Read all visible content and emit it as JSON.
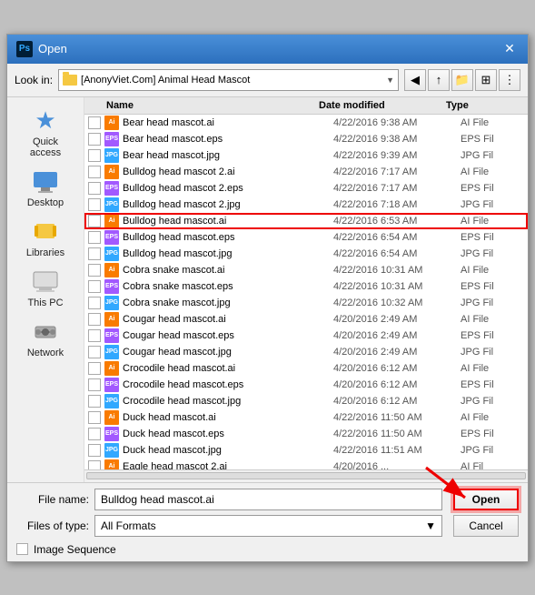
{
  "dialog": {
    "title": "Open",
    "ps_label": "Ps"
  },
  "toolbar": {
    "look_in_label": "Look in:",
    "look_in_value": "[AnonyViet.Com] Animal Head Mascot",
    "btn_back": "◀",
    "btn_up": "↑",
    "btn_folder": "📁",
    "btn_grid": "⊞",
    "btn_options": "⋮"
  },
  "sidebar": {
    "items": [
      {
        "id": "quick-access",
        "label": "Quick access",
        "icon": "star"
      },
      {
        "id": "desktop",
        "label": "Desktop",
        "icon": "desktop"
      },
      {
        "id": "libraries",
        "label": "Libraries",
        "icon": "libraries"
      },
      {
        "id": "this-pc",
        "label": "This PC",
        "icon": "pc"
      },
      {
        "id": "network",
        "label": "Network",
        "icon": "network"
      }
    ]
  },
  "file_list": {
    "columns": {
      "name": "Name",
      "date": "Date modified",
      "type": "Type"
    },
    "files": [
      {
        "name": "Bear head mascot.ai",
        "date": "4/22/2016 9:38 AM",
        "type": "AI File",
        "icon": "ai"
      },
      {
        "name": "Bear head mascot.eps",
        "date": "4/22/2016 9:38 AM",
        "type": "EPS Fil",
        "icon": "eps"
      },
      {
        "name": "Bear head mascot.jpg",
        "date": "4/22/2016 9:39 AM",
        "type": "JPG Fil",
        "icon": "jpg"
      },
      {
        "name": "Bulldog head mascot 2.ai",
        "date": "4/22/2016 7:17 AM",
        "type": "AI File",
        "icon": "ai"
      },
      {
        "name": "Bulldog head mascot 2.eps",
        "date": "4/22/2016 7:17 AM",
        "type": "EPS Fil",
        "icon": "eps"
      },
      {
        "name": "Bulldog head mascot 2.jpg",
        "date": "4/22/2016 7:18 AM",
        "type": "JPG Fil",
        "icon": "jpg"
      },
      {
        "name": "Bulldog head mascot.ai",
        "date": "4/22/2016 6:53 AM",
        "type": "AI File",
        "icon": "ai",
        "selected": true
      },
      {
        "name": "Bulldog head mascot.eps",
        "date": "4/22/2016 6:54 AM",
        "type": "EPS Fil",
        "icon": "eps"
      },
      {
        "name": "Bulldog head mascot.jpg",
        "date": "4/22/2016 6:54 AM",
        "type": "JPG Fil",
        "icon": "jpg"
      },
      {
        "name": "Cobra snake mascot.ai",
        "date": "4/22/2016 10:31 AM",
        "type": "AI File",
        "icon": "ai"
      },
      {
        "name": "Cobra snake mascot.eps",
        "date": "4/22/2016 10:31 AM",
        "type": "EPS Fil",
        "icon": "eps"
      },
      {
        "name": "Cobra snake mascot.jpg",
        "date": "4/22/2016 10:32 AM",
        "type": "JPG Fil",
        "icon": "jpg"
      },
      {
        "name": "Cougar head mascot.ai",
        "date": "4/20/2016 2:49 AM",
        "type": "AI File",
        "icon": "ai"
      },
      {
        "name": "Cougar head mascot.eps",
        "date": "4/20/2016 2:49 AM",
        "type": "EPS Fil",
        "icon": "eps"
      },
      {
        "name": "Cougar head mascot.jpg",
        "date": "4/20/2016 2:49 AM",
        "type": "JPG Fil",
        "icon": "jpg"
      },
      {
        "name": "Crocodile head mascot.ai",
        "date": "4/20/2016 6:12 AM",
        "type": "AI File",
        "icon": "ai"
      },
      {
        "name": "Crocodile head mascot.eps",
        "date": "4/20/2016 6:12 AM",
        "type": "EPS Fil",
        "icon": "eps"
      },
      {
        "name": "Crocodile head mascot.jpg",
        "date": "4/20/2016 6:12 AM",
        "type": "JPG Fil",
        "icon": "jpg"
      },
      {
        "name": "Duck head mascot.ai",
        "date": "4/22/2016 11:50 AM",
        "type": "AI File",
        "icon": "ai"
      },
      {
        "name": "Duck head mascot.eps",
        "date": "4/22/2016 11:50 AM",
        "type": "EPS Fil",
        "icon": "eps"
      },
      {
        "name": "Duck head mascot.jpg",
        "date": "4/22/2016 11:51 AM",
        "type": "JPG Fil",
        "icon": "jpg"
      },
      {
        "name": "Eagle head mascot 2.ai",
        "date": "4/20/2016 ...",
        "type": "AI Fil",
        "icon": "ai"
      }
    ]
  },
  "bottom": {
    "file_name_label": "File name:",
    "file_name_value": "Bulldog head mascot.ai",
    "file_type_label": "Files of type:",
    "file_type_value": "All Formats",
    "open_label": "Open",
    "cancel_label": "Cancel",
    "image_seq_label": "Image Sequence"
  }
}
